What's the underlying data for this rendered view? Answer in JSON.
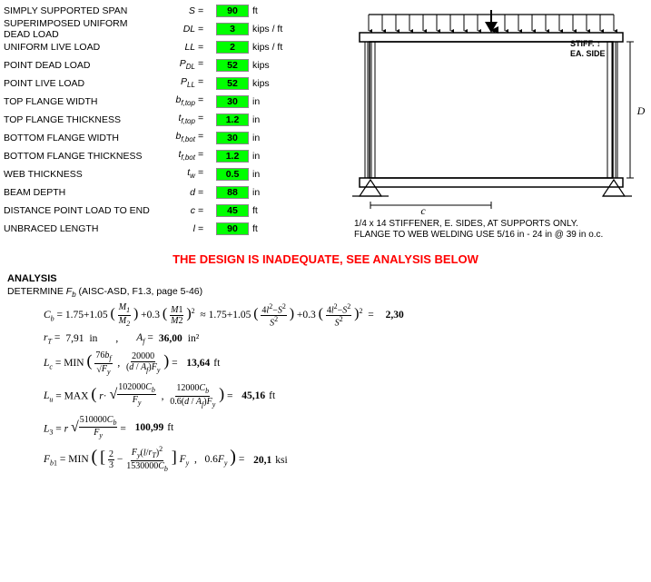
{
  "inputs": [
    {
      "label": "SIMPLY SUPPORTED SPAN",
      "symbol": "S =",
      "value": "90",
      "unit": "ft"
    },
    {
      "label": "SUPERIMPOSED UNIFORM DEAD LOAD",
      "symbol": "DL =",
      "value": "3",
      "unit": "kips / ft"
    },
    {
      "label": "UNIFORM LIVE LOAD",
      "symbol": "LL =",
      "value": "2",
      "unit": "kips / ft"
    },
    {
      "label": "POINT DEAD LOAD",
      "symbol": "PₚL =",
      "value": "52",
      "unit": "kips"
    },
    {
      "label": "POINT LIVE LOAD",
      "symbol": "PₚL =",
      "value": "52",
      "unit": "kips"
    },
    {
      "label": "TOP FLANGE WIDTH",
      "symbol": "bᵩ,top =",
      "value": "30",
      "unit": "in"
    },
    {
      "label": "TOP FLANGE THICKNESS",
      "symbol": "tᵩ,top =",
      "value": "1.2",
      "unit": "in"
    },
    {
      "label": "BOTTOM FLANGE WIDTH",
      "symbol": "bᵩ,bot =",
      "value": "30",
      "unit": "in"
    },
    {
      "label": "BOTTOM FLANGE THICKNESS",
      "symbol": "tᵩ,bot =",
      "value": "1.2",
      "unit": "in"
    },
    {
      "label": "WEB THICKNESS",
      "symbol": "tᵰ =",
      "value": "0.5",
      "unit": "in"
    },
    {
      "label": "BEAM DEPTH",
      "symbol": "d =",
      "value": "88",
      "unit": "in"
    },
    {
      "label": "DISTANCE POINT LOAD TO END",
      "symbol": "c =",
      "value": "45",
      "unit": "ft"
    },
    {
      "label": "UNBRACED LENGTH",
      "symbol": "l =",
      "value": "90",
      "unit": "ft"
    }
  ],
  "warning": "THE DESIGN IS INADEQUATE, SEE ANALYSIS BELOW",
  "analysis_header": "ANALYSIS",
  "analysis_sub": "DETERMINE Fᵇ (AISC-ASD, F1.3, page 5-46)",
  "stiff_note": "STIFF. ↕",
  "stiff_note2": "EA. SIDE",
  "beam_note1": "1/4 x 14 STIFFENER, E. SIDES, AT SUPPORTS ONLY.",
  "beam_note2": "FLANGE TO WEB WELDING USE 5/16 in -  24 in @ 39 in o.c.",
  "cb_label": "Cᵇ = 1.75+1.05",
  "cb_eq": "≈1.75+1.05",
  "cb_result": "2,30",
  "rt_label": "rᵀ =",
  "rt_value": "7,91",
  "rt_unit": "in",
  "af_label": "Aᵀ =",
  "af_value": "36,00",
  "af_unit": "in²",
  "lc_label": "Lᶜ = MIN",
  "lc_result": "13,64",
  "lc_unit": "ft",
  "lu_label": "Lᵤ = MAX",
  "lu_result": "45,16",
  "lu_unit": "ft",
  "l3_label": "L₃ = r",
  "l3_result": "100,99",
  "l3_unit": "ft",
  "fb1_label": "Fᵇ₁ = MIN",
  "fb1_result": "20,1",
  "fb1_unit": "ksi"
}
